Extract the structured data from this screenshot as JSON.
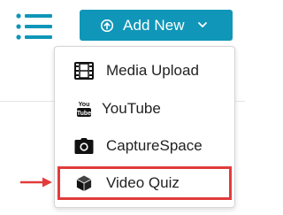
{
  "toolbar": {
    "add_new_label": "Add New"
  },
  "menu": {
    "items": [
      {
        "label": "Media Upload",
        "icon": "film-icon"
      },
      {
        "label": "YouTube",
        "icon": "youtube-icon"
      },
      {
        "label": "CaptureSpace",
        "icon": "camera-icon"
      },
      {
        "label": "Video Quiz",
        "icon": "cube-icon",
        "highlighted": true
      }
    ]
  },
  "colors": {
    "accent": "#0f96b8",
    "highlight": "#e23b3b",
    "text": "#222222"
  }
}
